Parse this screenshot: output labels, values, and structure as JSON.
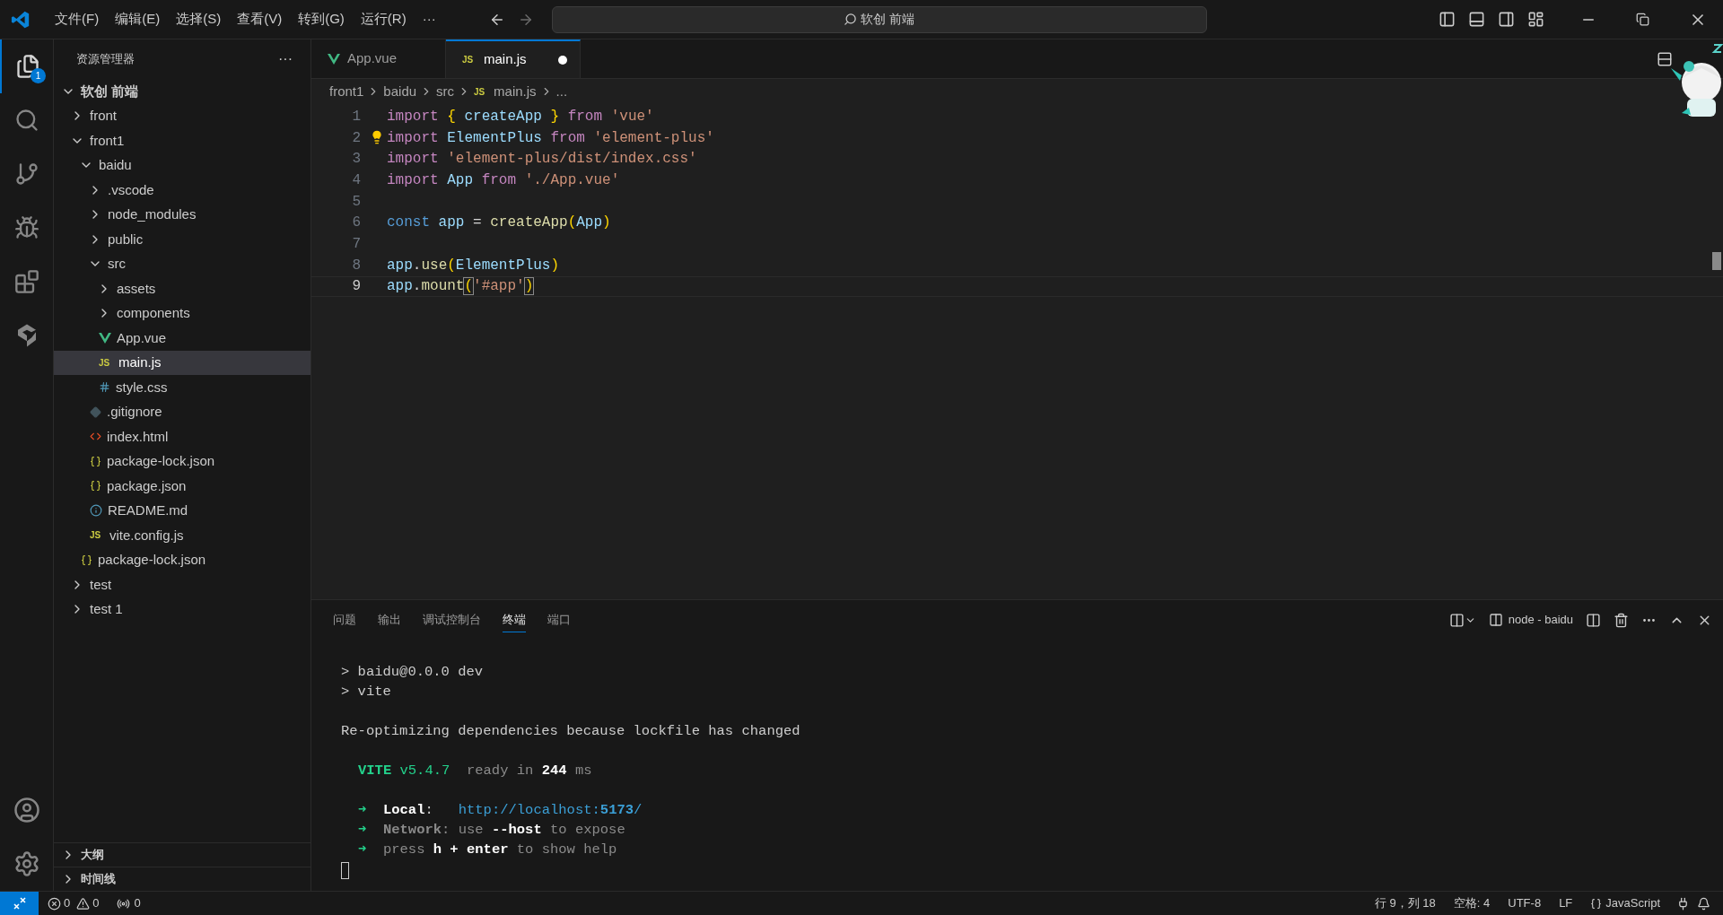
{
  "menu": [
    "文件(F)",
    "编辑(E)",
    "选择(S)",
    "查看(V)",
    "转到(G)",
    "运行(R)",
    "···"
  ],
  "command_center": {
    "value": "软创 前端"
  },
  "activity_bar": {
    "explorer_badge": "1"
  },
  "explorer": {
    "title": "资源管理器",
    "more": "···",
    "tree": [
      {
        "label": "软创 前端",
        "kind": "root",
        "expanded": true,
        "children": [
          {
            "label": "front",
            "kind": "folder",
            "expanded": false
          },
          {
            "label": "front1",
            "kind": "folder",
            "expanded": true,
            "children": [
              {
                "label": "baidu",
                "kind": "folder",
                "expanded": true,
                "children": [
                  {
                    "label": ".vscode",
                    "kind": "folder",
                    "expanded": false
                  },
                  {
                    "label": "node_modules",
                    "kind": "folder",
                    "expanded": false
                  },
                  {
                    "label": "public",
                    "kind": "folder",
                    "expanded": false
                  },
                  {
                    "label": "src",
                    "kind": "folder",
                    "expanded": true,
                    "children": [
                      {
                        "label": "assets",
                        "kind": "folder",
                        "expanded": false
                      },
                      {
                        "label": "components",
                        "kind": "folder",
                        "expanded": false
                      },
                      {
                        "label": "App.vue",
                        "kind": "vue",
                        "selected": false
                      },
                      {
                        "label": "main.js",
                        "kind": "js",
                        "icon_label": "JS",
                        "selected": true
                      },
                      {
                        "label": "style.css",
                        "kind": "css",
                        "selected": false
                      }
                    ]
                  },
                  {
                    "label": ".gitignore",
                    "kind": "git",
                    "selected": false
                  },
                  {
                    "label": "index.html",
                    "kind": "html",
                    "selected": false
                  },
                  {
                    "label": "package-lock.json",
                    "kind": "json",
                    "selected": false
                  },
                  {
                    "label": "package.json",
                    "kind": "json",
                    "selected": false
                  },
                  {
                    "label": "README.md",
                    "kind": "info",
                    "selected": false
                  },
                  {
                    "label": "vite.config.js",
                    "kind": "js",
                    "icon_label": "JS",
                    "selected": false
                  }
                ]
              },
              {
                "label": "package-lock.json",
                "kind": "json",
                "selected": false
              }
            ]
          },
          {
            "label": "test",
            "kind": "folder",
            "expanded": false
          },
          {
            "label": "test 1",
            "kind": "folder",
            "expanded": false
          }
        ]
      }
    ],
    "sections": [
      {
        "label": "大纲",
        "expanded": false
      },
      {
        "label": "时间线",
        "expanded": false
      }
    ]
  },
  "tabs": [
    {
      "label": "App.vue",
      "kind": "vue",
      "selected": false,
      "modified": false
    },
    {
      "label": "main.js",
      "kind": "js",
      "icon_label": "JS",
      "selected": true,
      "modified": true
    }
  ],
  "breadcrumbs": [
    {
      "label": "front1"
    },
    {
      "label": "baidu"
    },
    {
      "label": "src"
    },
    {
      "label": "main.js",
      "kind": "js",
      "icon_label": "JS"
    },
    {
      "label": "..."
    }
  ],
  "code": [
    {
      "number": "1",
      "current": false,
      "tokens": [
        {
          "text": "import ",
          "kind": "keyword"
        },
        {
          "text": "{",
          "kind": "brace"
        },
        {
          "text": " createApp ",
          "kind": "variable"
        },
        {
          "text": "}",
          "kind": "brace"
        },
        {
          "text": " from ",
          "kind": "keyword"
        },
        {
          "text": "'vue'",
          "kind": "string"
        }
      ]
    },
    {
      "number": "2",
      "current": false,
      "lightbulb": true,
      "tokens": [
        {
          "text": "import ",
          "kind": "keyword"
        },
        {
          "text": "ElementPlus ",
          "kind": "variable"
        },
        {
          "text": "from ",
          "kind": "keyword"
        },
        {
          "text": "'element-plus'",
          "kind": "string"
        }
      ]
    },
    {
      "number": "3",
      "current": false,
      "tokens": [
        {
          "text": "import ",
          "kind": "keyword"
        },
        {
          "text": "'element-plus/dist/index.css'",
          "kind": "string"
        }
      ]
    },
    {
      "number": "4",
      "current": false,
      "tokens": [
        {
          "text": "import ",
          "kind": "keyword"
        },
        {
          "text": "App ",
          "kind": "variable"
        },
        {
          "text": "from ",
          "kind": "keyword"
        },
        {
          "text": "'./App.vue'",
          "kind": "string"
        }
      ]
    },
    {
      "number": "5",
      "current": false
    },
    {
      "number": "6",
      "current": false,
      "tokens": [
        {
          "text": "const ",
          "kind": "declaration"
        },
        {
          "text": "app ",
          "kind": "variable"
        },
        {
          "text": "= ",
          "kind": "plain"
        },
        {
          "text": "createApp",
          "kind": "function"
        },
        {
          "text": "(",
          "kind": "brace"
        },
        {
          "text": "App",
          "kind": "variable"
        },
        {
          "text": ")",
          "kind": "brace"
        }
      ]
    },
    {
      "number": "7",
      "current": false
    },
    {
      "number": "8",
      "current": false,
      "tokens": [
        {
          "text": "app",
          "kind": "variable"
        },
        {
          "text": ".",
          "kind": "plain"
        },
        {
          "text": "use",
          "kind": "function"
        },
        {
          "text": "(",
          "kind": "brace"
        },
        {
          "text": "ElementPlus",
          "kind": "variable"
        },
        {
          "text": ")",
          "kind": "brace"
        }
      ]
    },
    {
      "number": "9",
      "current": true,
      "tokens": [
        {
          "text": "app",
          "kind": "variable"
        },
        {
          "text": ".",
          "kind": "plain"
        },
        {
          "text": "mount",
          "kind": "function"
        },
        {
          "text": "(",
          "kind": "matched"
        },
        {
          "text": "'#app'",
          "kind": "string"
        },
        {
          "text": ")",
          "kind": "matched"
        }
      ]
    }
  ],
  "panel": {
    "tabs": [
      {
        "label": "问题",
        "selected": false
      },
      {
        "label": "输出",
        "selected": false
      },
      {
        "label": "调试控制台",
        "selected": false
      },
      {
        "label": "终端",
        "selected": true
      },
      {
        "label": "端口",
        "selected": false
      }
    ],
    "terminal_name": "node - baidu",
    "terminal": [
      {
        "lines": [
          {
            "segments": [
              {
                "text": "> baidu@0.0.0 dev",
                "kind": "plain"
              }
            ]
          },
          {
            "segments": [
              {
                "text": "> vite",
                "kind": "plain"
              }
            ]
          }
        ]
      },
      {
        "lines": [
          {
            "segments": [
              {
                "text": "Re-optimizing dependencies because lockfile has changed",
                "kind": "plain"
              }
            ]
          }
        ]
      },
      {
        "lines": [
          {
            "segments": [
              {
                "text": "VITE",
                "kind": "greenbold"
              },
              {
                "text": " v5.4.7",
                "kind": "green"
              },
              {
                "text": "  ready in ",
                "kind": "dim"
              },
              {
                "text": "244",
                "kind": "bold"
              },
              {
                "text": " ms",
                "kind": "dim"
              }
            ]
          }
        ]
      },
      {
        "lines": [
          {
            "segments": [
              {
                "text": "➜",
                "kind": "green"
              },
              {
                "text": "  Local",
                "kind": "bold"
              },
              {
                "text": ":   ",
                "kind": "plain"
              },
              {
                "text": "http://localhost:",
                "kind": "link"
              },
              {
                "text": "5173",
                "kind": "linkbold"
              },
              {
                "text": "/",
                "kind": "link"
              }
            ]
          },
          {
            "segments": [
              {
                "text": "➜",
                "kind": "green"
              },
              {
                "text": "  Network",
                "kind": "dimbold"
              },
              {
                "text": ": use ",
                "kind": "dim"
              },
              {
                "text": "--host",
                "kind": "bold"
              },
              {
                "text": " to expose",
                "kind": "dim"
              }
            ]
          },
          {
            "segments": [
              {
                "text": "➜",
                "kind": "green"
              },
              {
                "text": "  press ",
                "kind": "dim"
              },
              {
                "text": "h + enter",
                "kind": "bold"
              },
              {
                "text": " to show help",
                "kind": "dim"
              }
            ]
          }
        ]
      }
    ]
  },
  "status_bar": {
    "errors": "0",
    "warnings": "0",
    "ports": "0",
    "position": "行 9，列 18",
    "indent": "空格: 4",
    "encoding": "UTF-8",
    "eol": "LF",
    "language": "JavaScript"
  }
}
